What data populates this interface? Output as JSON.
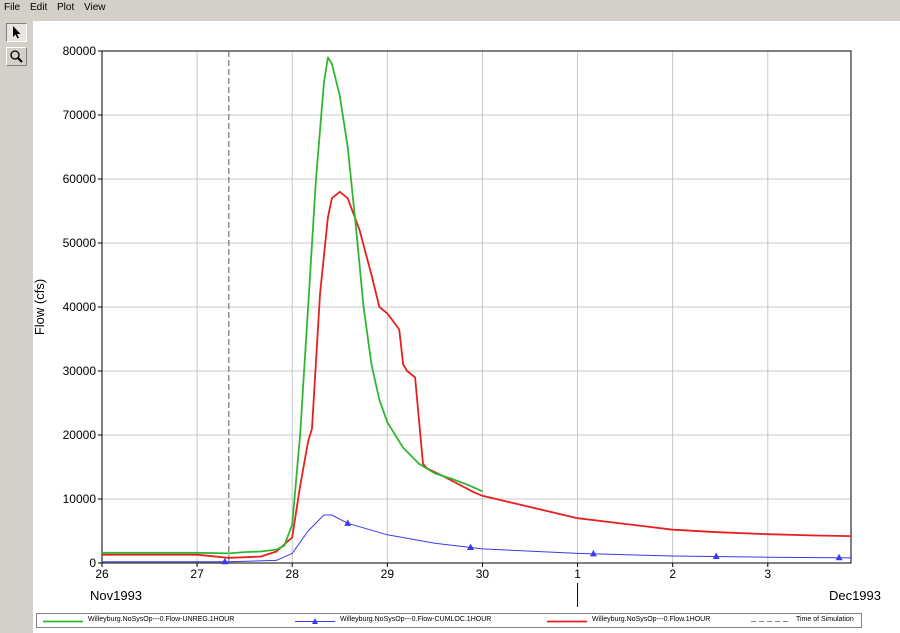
{
  "menu": {
    "items": [
      {
        "label": "File"
      },
      {
        "label": "Edit"
      },
      {
        "label": "Plot"
      },
      {
        "label": "View"
      }
    ]
  },
  "toolbar": {
    "tools": [
      {
        "icon": "pointer-arrow-icon",
        "active": true
      },
      {
        "icon": "magnifier-icon",
        "active": false
      }
    ]
  },
  "chart_data": {
    "type": "line",
    "title": "",
    "xlabel": "",
    "ylabel": "Flow (cfs)",
    "xlim": [
      "1993-11-26T00:00",
      "1993-12-03T21:00"
    ],
    "ylim": [
      0,
      80000
    ],
    "yticks": [
      "0",
      "10000",
      "20000",
      "30000",
      "40000",
      "50000",
      "60000",
      "70000",
      "80000"
    ],
    "xticks": [
      {
        "label": "26",
        "x": "1993-11-26T00:00"
      },
      {
        "label": "27",
        "x": "1993-11-27T00:00"
      },
      {
        "label": "28",
        "x": "1993-11-28T00:00"
      },
      {
        "label": "29",
        "x": "1993-11-29T00:00"
      },
      {
        "label": "30",
        "x": "1993-11-30T00:00"
      },
      {
        "label": "1",
        "x": "1993-12-01T00:00"
      },
      {
        "label": "2",
        "x": "1993-12-02T00:00"
      },
      {
        "label": "3",
        "x": "1993-12-03T00:00"
      }
    ],
    "month_labels": [
      {
        "label": "Nov1993",
        "x": "1993-11-26T00:00"
      },
      {
        "label": "Dec1993",
        "x": "1993-12-03T21:00"
      }
    ],
    "month_boundary": "1993-12-01T00:00",
    "grid": true,
    "legend_position": "bottom",
    "time_of_simulation": "1993-11-27T08:00",
    "series": [
      {
        "name": "Willeyburg.NoSysOp---0.Flow-UNREG.1HOUR",
        "color": "#2fb82f",
        "marker": "none",
        "x": [
          "1993-11-26T00:00",
          "1993-11-27T00:00",
          "1993-11-27T08:00",
          "1993-11-27T12:00",
          "1993-11-27T16:00",
          "1993-11-27T20:00",
          "1993-11-27T22:00",
          "1993-11-28T00:00",
          "1993-11-28T02:00",
          "1993-11-28T04:00",
          "1993-11-28T06:00",
          "1993-11-28T08:00",
          "1993-11-28T09:00",
          "1993-11-28T10:00",
          "1993-11-28T12:00",
          "1993-11-28T14:00",
          "1993-11-28T16:00",
          "1993-11-28T18:00",
          "1993-11-28T20:00",
          "1993-11-28T22:00",
          "1993-11-29T00:00",
          "1993-11-29T04:00",
          "1993-11-29T08:00",
          "1993-11-29T12:00",
          "1993-11-29T16:00",
          "1993-11-29T20:00",
          "1993-11-30T00:00"
        ],
        "y": [
          1600,
          1600,
          1500,
          1700,
          1800,
          2100,
          2700,
          6000,
          20000,
          40000,
          60000,
          75000,
          79000,
          78000,
          73000,
          65000,
          53000,
          40000,
          31000,
          25500,
          22000,
          18000,
          15500,
          14000,
          13200,
          12300,
          11200
        ]
      },
      {
        "name": "Willeyburg.NoSysOp---0.Flow-CUMLOC.1HOUR",
        "color": "#3b3bea",
        "marker": "triangle",
        "x": [
          "1993-11-26T00:00",
          "1993-11-27T08:00",
          "1993-11-27T20:00",
          "1993-11-28T00:00",
          "1993-11-28T04:00",
          "1993-11-28T08:00",
          "1993-11-28T10:00",
          "1993-11-28T14:00",
          "1993-11-29T00:00",
          "1993-11-29T12:00",
          "1993-11-30T00:00",
          "1993-12-01T00:00",
          "1993-12-02T00:00",
          "1993-12-03T00:00",
          "1993-12-03T21:00"
        ],
        "y": [
          200,
          200,
          400,
          1500,
          5000,
          7500,
          7500,
          6200,
          4400,
          3100,
          2200,
          1500,
          1100,
          900,
          800
        ],
        "markers_at": [
          "1993-11-27T07:00",
          "1993-11-28T14:00",
          "1993-11-29T21:00",
          "1993-12-01T04:00",
          "1993-12-02T11:00",
          "1993-12-03T18:00"
        ]
      },
      {
        "name": "Willeyburg.NoSysOp---0.Flow.1HOUR",
        "color": "#e62020",
        "marker": "none",
        "x": [
          "1993-11-26T00:00",
          "1993-11-27T00:00",
          "1993-11-27T08:00",
          "1993-11-27T16:00",
          "1993-11-27T20:00",
          "1993-11-28T00:00",
          "1993-11-28T02:00",
          "1993-11-28T04:00",
          "1993-11-28T05:00",
          "1993-11-28T07:00",
          "1993-11-28T09:00",
          "1993-11-28T10:00",
          "1993-11-28T12:00",
          "1993-11-28T14:00",
          "1993-11-28T17:00",
          "1993-11-28T20:00",
          "1993-11-28T22:00",
          "1993-11-29T00:00",
          "1993-11-29T03:00",
          "1993-11-29T04:00",
          "1993-11-29T05:00",
          "1993-11-29T07:00",
          "1993-11-29T09:00",
          "1993-11-29T10:00",
          "1993-11-29T14:00",
          "1993-11-29T22:00",
          "1993-11-30T00:00",
          "1993-12-01T00:00",
          "1993-12-02T00:00",
          "1993-12-02T12:00",
          "1993-12-03T00:00",
          "1993-12-03T12:00",
          "1993-12-03T21:00"
        ],
        "y": [
          1300,
          1300,
          800,
          1000,
          1800,
          4000,
          12000,
          19000,
          21000,
          42000,
          54000,
          57000,
          58000,
          57000,
          52000,
          45000,
          40000,
          39000,
          36500,
          31000,
          30000,
          29000,
          15500,
          14800,
          13600,
          11000,
          10500,
          7000,
          5200,
          4800,
          4500,
          4300,
          4200
        ]
      },
      {
        "name": "Time of Simulation",
        "color": "#808080",
        "marker": "none",
        "style": "dashed"
      }
    ]
  }
}
